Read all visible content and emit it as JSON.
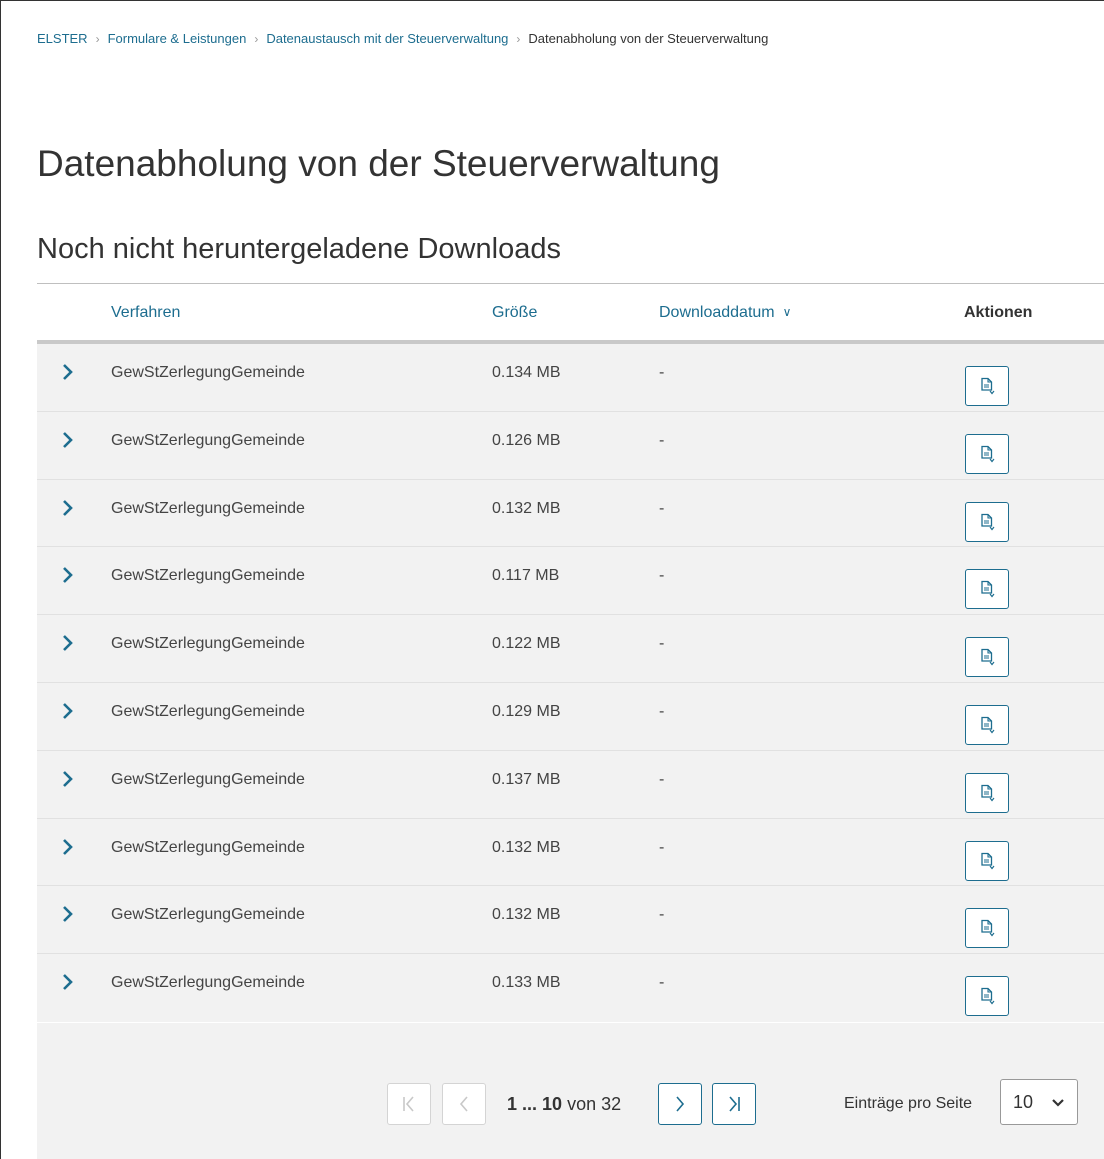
{
  "breadcrumb": {
    "items": [
      "ELSTER",
      "Formulare & Leistungen",
      "Datenaustausch mit der Steuerverwaltung"
    ],
    "current": "Datenabholung von der Steuerverwaltung"
  },
  "page_title": "Datenabholung von der Steuerverwaltung",
  "section_title": "Noch nicht heruntergeladene Downloads",
  "table": {
    "headers": {
      "verfahren": "Verfahren",
      "groesse": "Größe",
      "downloaddatum": "Downloaddatum",
      "aktionen": "Aktionen"
    },
    "rows": [
      {
        "verfahren": "GewStZerlegungGemeinde",
        "groesse": "0.134 MB",
        "downloaddatum": "-"
      },
      {
        "verfahren": "GewStZerlegungGemeinde",
        "groesse": "0.126 MB",
        "downloaddatum": "-"
      },
      {
        "verfahren": "GewStZerlegungGemeinde",
        "groesse": "0.132 MB",
        "downloaddatum": "-"
      },
      {
        "verfahren": "GewStZerlegungGemeinde",
        "groesse": "0.117 MB",
        "downloaddatum": "-"
      },
      {
        "verfahren": "GewStZerlegungGemeinde",
        "groesse": "0.122 MB",
        "downloaddatum": "-"
      },
      {
        "verfahren": "GewStZerlegungGemeinde",
        "groesse": "0.129 MB",
        "downloaddatum": "-"
      },
      {
        "verfahren": "GewStZerlegungGemeinde",
        "groesse": "0.137 MB",
        "downloaddatum": "-"
      },
      {
        "verfahren": "GewStZerlegungGemeinde",
        "groesse": "0.132 MB",
        "downloaddatum": "-"
      },
      {
        "verfahren": "GewStZerlegungGemeinde",
        "groesse": "0.132 MB",
        "downloaddatum": "-"
      },
      {
        "verfahren": "GewStZerlegungGemeinde",
        "groesse": "0.133 MB",
        "downloaddatum": "-"
      }
    ]
  },
  "pagination": {
    "range": "1 ... 10",
    "von_label": "von",
    "total": "32",
    "per_page_label": "Einträge pro Seite",
    "per_page_value": "10"
  },
  "colors": {
    "accent": "#1d6d8f",
    "row_bg": "#f2f2f2",
    "header_rule": "#c9c9c9"
  }
}
